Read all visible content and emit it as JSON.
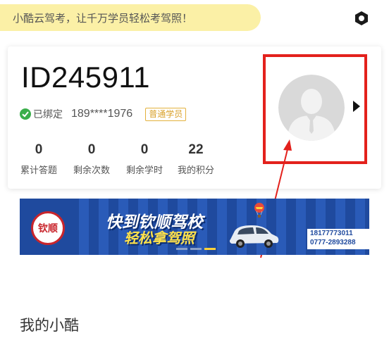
{
  "banner": {
    "text": "小酷云驾考，让千万学员轻松考驾照！"
  },
  "header": {
    "settings_icon": "gear-hexagon-icon"
  },
  "profile": {
    "user_id": "ID245911",
    "bind_status": "已绑定",
    "phone": "189****1976",
    "member_badge": "普通学员",
    "stats": [
      {
        "value": "0",
        "label": "累计答题"
      },
      {
        "value": "0",
        "label": "剩余次数"
      },
      {
        "value": "0",
        "label": "剩余学时"
      },
      {
        "value": "22",
        "label": "我的积分"
      }
    ]
  },
  "ad": {
    "logo_text": "钦顺",
    "line1": "快到钦顺驾校",
    "line2": "轻松拿驾照",
    "phones": [
      "18177773011",
      "0777-2893288"
    ]
  },
  "section": {
    "title": "我的小酷"
  },
  "colors": {
    "banner_bg": "#fbf0a6",
    "badge": "#d9a12b",
    "check_green": "#3aae4a",
    "highlight_red": "#e3211c",
    "ad_blue": "#1f4a9e"
  }
}
